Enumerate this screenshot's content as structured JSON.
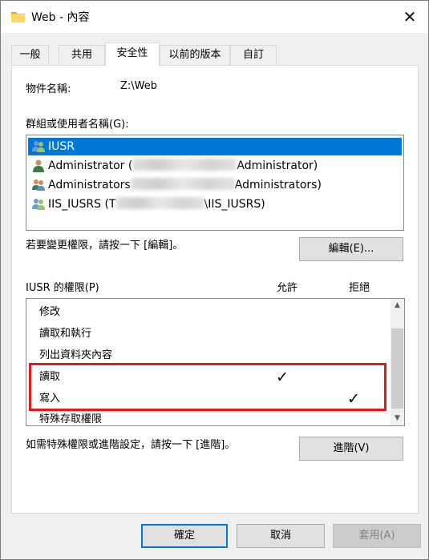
{
  "window": {
    "title": "Web - 內容",
    "close_symbol": "✕",
    "icon": "folder-icon"
  },
  "tabs": [
    {
      "label": "一般",
      "active": false
    },
    {
      "label": "共用",
      "active": false
    },
    {
      "label": "安全性",
      "active": true
    },
    {
      "label": "以前的版本",
      "active": false
    },
    {
      "label": "自訂",
      "active": false
    }
  ],
  "security": {
    "object_name_label": "物件名稱:",
    "object_name_value": "Z:\\Web",
    "groups_label": "群組或使用者名稱(G):",
    "groups": [
      {
        "name": "IUSR",
        "icon": "users-group-icon",
        "selected": true
      },
      {
        "name_prefix": "Administrator (",
        "name_suffix": "Administrator)",
        "icon": "user-icon",
        "selected": false
      },
      {
        "name_prefix": "Administrators",
        "name_suffix": "Administrators)",
        "icon": "users-group-icon",
        "selected": false
      },
      {
        "name_prefix": "IIS_IUSRS (T",
        "name_suffix": "\\IIS_IUSRS)",
        "icon": "users-group-icon",
        "selected": false
      }
    ],
    "edit_hint": "若要變更權限，請按一下 [編輯]。",
    "edit_button": "編輯(E)...",
    "permissions_label": "IUSR 的權限(P)",
    "allow_header": "允許",
    "deny_header": "拒絕",
    "permissions": [
      {
        "name": "修改",
        "allow": false,
        "deny": false
      },
      {
        "name": "讀取和執行",
        "allow": false,
        "deny": false
      },
      {
        "name": "列出資料夾內容",
        "allow": false,
        "deny": false
      },
      {
        "name": "讀取",
        "allow": true,
        "deny": false
      },
      {
        "name": "寫入",
        "allow": false,
        "deny": true
      },
      {
        "name": "特殊存取權限",
        "allow": false,
        "deny": false
      }
    ],
    "check_symbol": "✓",
    "advanced_hint": "如需特殊權限或進階設定，請按一下 [進階]。",
    "advanced_button": "進階(V)",
    "highlight_color": "#e01b1b"
  },
  "footer": {
    "ok": "確定",
    "cancel": "取消",
    "apply": "套用(A)"
  },
  "colors": {
    "selection": "#0078d7",
    "button_face": "#e1e1e1",
    "window_bg": "#f0f0f0"
  }
}
